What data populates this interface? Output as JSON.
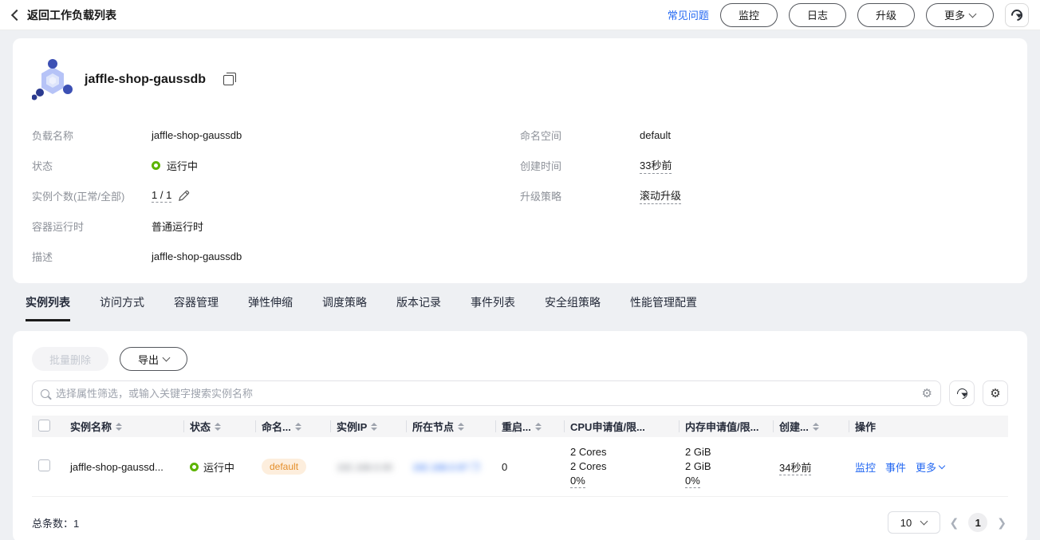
{
  "colors": {
    "accent_blue": "#2468f2",
    "status_green": "#5cb300",
    "badge_bg": "#fdeedd",
    "badge_text": "#e48e2a",
    "page_bg": "#eef0f3"
  },
  "topbar": {
    "back_label": "返回工作负载列表",
    "faq_link": "常见问题",
    "monitor_btn": "监控",
    "logs_btn": "日志",
    "upgrade_btn": "升级",
    "more_btn": "更多"
  },
  "workload": {
    "title": "jaffle-shop-gaussdb",
    "fields_left": [
      {
        "label": "负载名称",
        "value": "jaffle-shop-gaussdb"
      },
      {
        "label": "状态",
        "value": "运行中"
      },
      {
        "label": "实例个数(正常/全部)",
        "value": "1 / 1"
      },
      {
        "label": "容器运行时",
        "value": "普通运行时"
      },
      {
        "label": "描述",
        "value": "jaffle-shop-gaussdb"
      }
    ],
    "fields_right": [
      {
        "label": "命名空间",
        "value": "default"
      },
      {
        "label": "创建时间",
        "value": "33秒前"
      },
      {
        "label": "升级策略",
        "value": "滚动升级"
      }
    ]
  },
  "tabs": {
    "items": [
      {
        "label": "实例列表",
        "active": true
      },
      {
        "label": "访问方式"
      },
      {
        "label": "容器管理"
      },
      {
        "label": "弹性伸缩"
      },
      {
        "label": "调度策略"
      },
      {
        "label": "版本记录"
      },
      {
        "label": "事件列表"
      },
      {
        "label": "安全组策略"
      },
      {
        "label": "性能管理配置"
      }
    ]
  },
  "table": {
    "batch_delete_label": "批量删除",
    "export_label": "导出",
    "search_placeholder": "选择属性筛选，或输入关键字搜索实例名称",
    "columns": [
      {
        "label": "实例名称",
        "sortable": true
      },
      {
        "label": "状态",
        "sortable": true
      },
      {
        "label": "命名...",
        "sortable": true
      },
      {
        "label": "实例IP",
        "sortable": true
      },
      {
        "label": "所在节点",
        "sortable": true
      },
      {
        "label": "重启...",
        "sortable": true
      },
      {
        "label": "CPU申请值/限...",
        "sortable": false
      },
      {
        "label": "内存申请值/限...",
        "sortable": false
      },
      {
        "label": "创建...",
        "sortable": true
      },
      {
        "label": "操作",
        "sortable": false
      }
    ],
    "row": {
      "name": "jaffle-shop-gaussd...",
      "status": "运行中",
      "namespace": "default",
      "restarts": "0",
      "cpu": {
        "request": "2 Cores",
        "limit": "2 Cores",
        "usage": "0%"
      },
      "memory": {
        "request": "2 GiB",
        "limit": "2 GiB",
        "usage": "0%"
      },
      "created": "34秒前",
      "actions": {
        "monitor": "监控",
        "events": "事件",
        "more": "更多"
      }
    },
    "footer": {
      "total_label": "总条数：",
      "total_count": "1",
      "page_size": "10",
      "current_page": "1"
    }
  }
}
